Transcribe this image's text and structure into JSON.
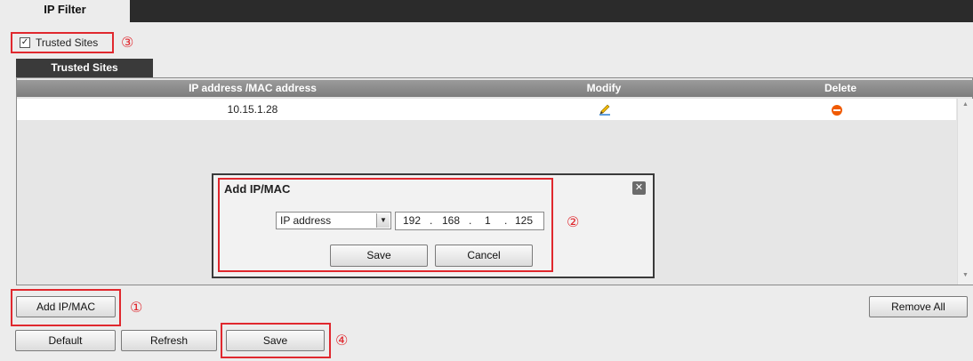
{
  "tabs": {
    "ip_filter": "IP Filter"
  },
  "trusted_sites_checkbox": {
    "label": "Trusted Sites",
    "checked_glyph": "✓"
  },
  "subtab": {
    "label": "Trusted Sites"
  },
  "table": {
    "columns": [
      "IP address /MAC address",
      "Modify",
      "Delete"
    ],
    "rows": [
      {
        "address": "10.15.1.28",
        "modify_icon": "pencil-icon",
        "delete_icon": "remove-icon"
      }
    ]
  },
  "dialog": {
    "title": "Add IP/MAC",
    "close_glyph": "✕",
    "type_select": "IP address",
    "ip": [
      "192",
      "168",
      "1",
      "125"
    ],
    "ip_dot": ".",
    "save_label": "Save",
    "cancel_label": "Cancel"
  },
  "buttons": {
    "add_ipmac": "Add IP/MAC",
    "remove_all": "Remove All",
    "default": "Default",
    "refresh": "Refresh",
    "save": "Save"
  },
  "annotations": {
    "one": "①",
    "two": "②",
    "three": "③",
    "four": "④"
  },
  "colors": {
    "annotation_red": "#e0282e",
    "delete_orange": "#f05a00",
    "header_gray": "#8a8a8a",
    "dark_bar": "#2b2b2b"
  }
}
